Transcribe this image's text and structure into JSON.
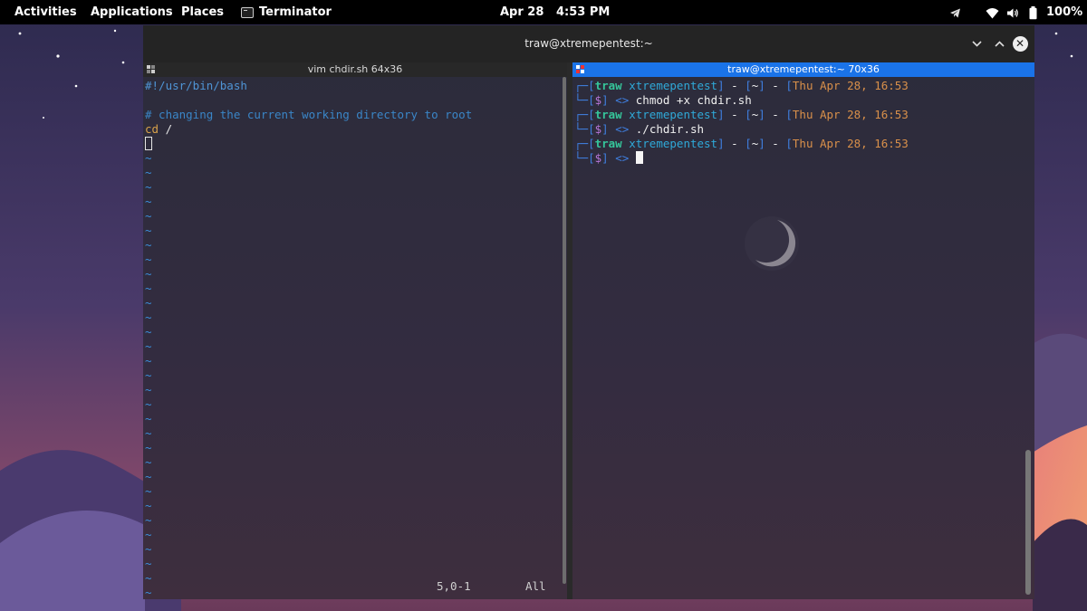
{
  "topbar": {
    "activities": "Activities",
    "applications": "Applications",
    "places": "Places",
    "app_name": "Terminator",
    "date": "Apr 28",
    "time": "4:53 PM",
    "battery": "100%"
  },
  "window": {
    "title": "traw@xtremepentest:~"
  },
  "left_pane": {
    "header": "vim chdir.sh 64x36",
    "lines": [
      {
        "text": "#!/usr/bin/bash",
        "style": "shebang"
      },
      {
        "text": "",
        "style": "plain"
      },
      {
        "text": "# changing the current working directory to root",
        "style": "comment"
      },
      {
        "text_cmd": "cd",
        "text_arg": " /"
      }
    ],
    "tilde": "~",
    "tilde_count": 31,
    "status_pos": "5,0-1",
    "status_all": "All"
  },
  "right_pane": {
    "header": "traw@xtremepentest:~ 70x36",
    "prompt": {
      "corner_top": "┌─",
      "corner_bottom": "└─",
      "bracket_open": "[",
      "bracket_close": "]",
      "user": "traw",
      "host": "xtremepentest",
      "dash": " - ",
      "dir": "~",
      "date": "Thu Apr 28, 16:53",
      "dollar": "$",
      "arrow": "<>"
    },
    "commands": [
      "chmod +x chdir.sh",
      "./chdir.sh",
      ""
    ]
  },
  "colors": {
    "accent": "#1a73e8",
    "user": "#35c59a",
    "date": "#d9904a",
    "dollar": "#b676d8",
    "bracket": "#3f7fe0"
  },
  "icons": {
    "telegram": "telegram-icon",
    "wifi": "wifi-icon",
    "volume": "volume-icon",
    "battery": "battery-icon",
    "terminal": "terminal-icon",
    "minimize": "chevron-down-icon",
    "maximize": "chevron-up-icon",
    "close": "close-icon"
  }
}
